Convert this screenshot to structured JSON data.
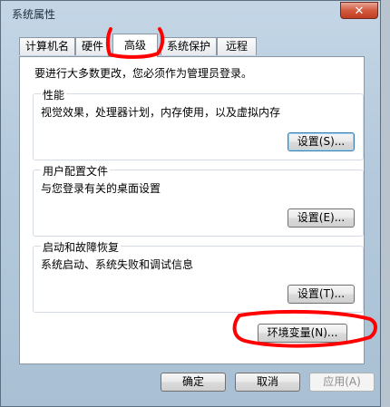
{
  "window": {
    "title": "系统属性",
    "close_label": "✕"
  },
  "tabs": [
    {
      "label": "计算机名"
    },
    {
      "label": "硬件"
    },
    {
      "label": "高级"
    },
    {
      "label": "系统保护"
    },
    {
      "label": "远程"
    }
  ],
  "advanced": {
    "admin_note": "要进行大多数更改，您必须作为管理员登录。",
    "performance": {
      "heading": "性能",
      "description": "视觉效果，处理器计划，内存使用，以及虚拟内存",
      "button": "设置(S)..."
    },
    "user_profiles": {
      "heading": "用户配置文件",
      "description": "与您登录有关的桌面设置",
      "button": "设置(E)..."
    },
    "startup_recovery": {
      "heading": "启动和故障恢复",
      "description": "系统启动、系统失败和调试信息",
      "button": "设置(T)..."
    },
    "env_button": "环境变量(N)..."
  },
  "footer": {
    "ok": "确定",
    "cancel": "取消",
    "apply": "应用(A)"
  },
  "colors": {
    "annotation": "#ff0000"
  }
}
